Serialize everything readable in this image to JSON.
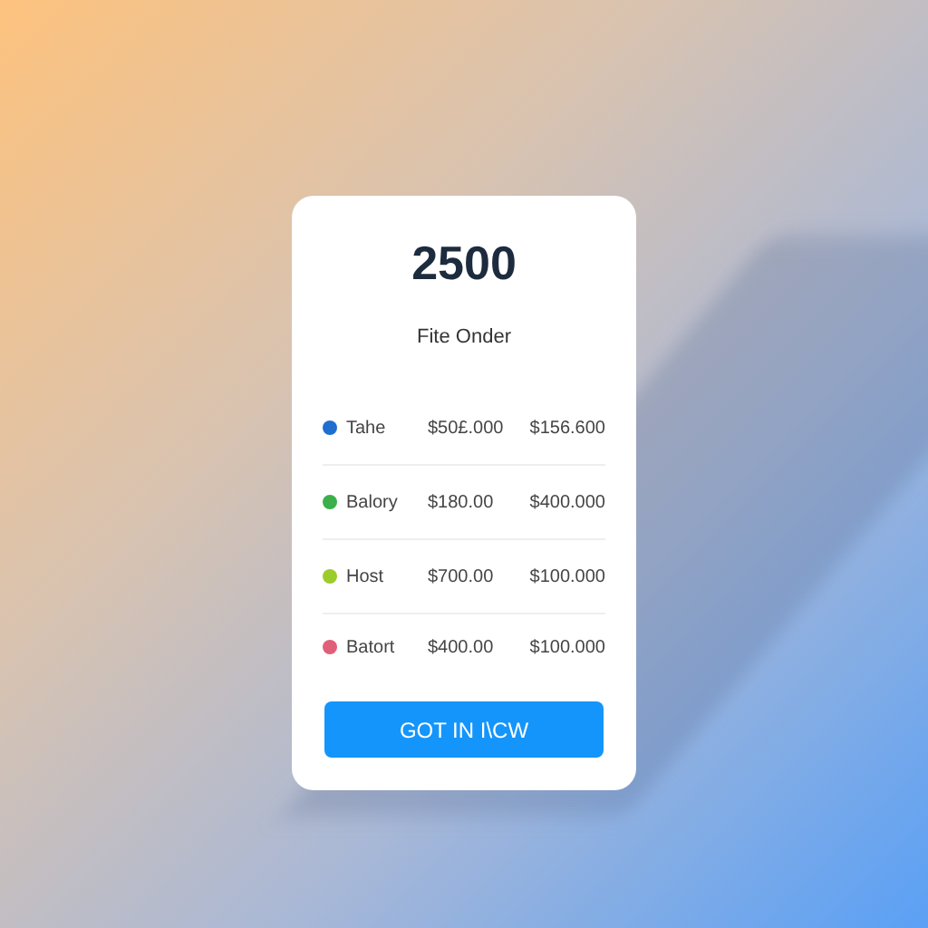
{
  "card": {
    "amount": "2500",
    "subtitle": "Fite Onder",
    "rows": [
      {
        "name": "Tahe",
        "color": "#1e6fd0",
        "price": "$50£.000",
        "total": "$156.600"
      },
      {
        "name": "Balory",
        "color": "#3bb04a",
        "price": "$180.00",
        "total": "$400.000"
      },
      {
        "name": "Host",
        "color": "#9ccc2a",
        "price": "$700.00",
        "total": "$100.000"
      },
      {
        "name": "Batort",
        "color": "#e0607a",
        "price": "$400.00",
        "total": "$100.000"
      }
    ],
    "button": "GOT IN I\\CW"
  }
}
